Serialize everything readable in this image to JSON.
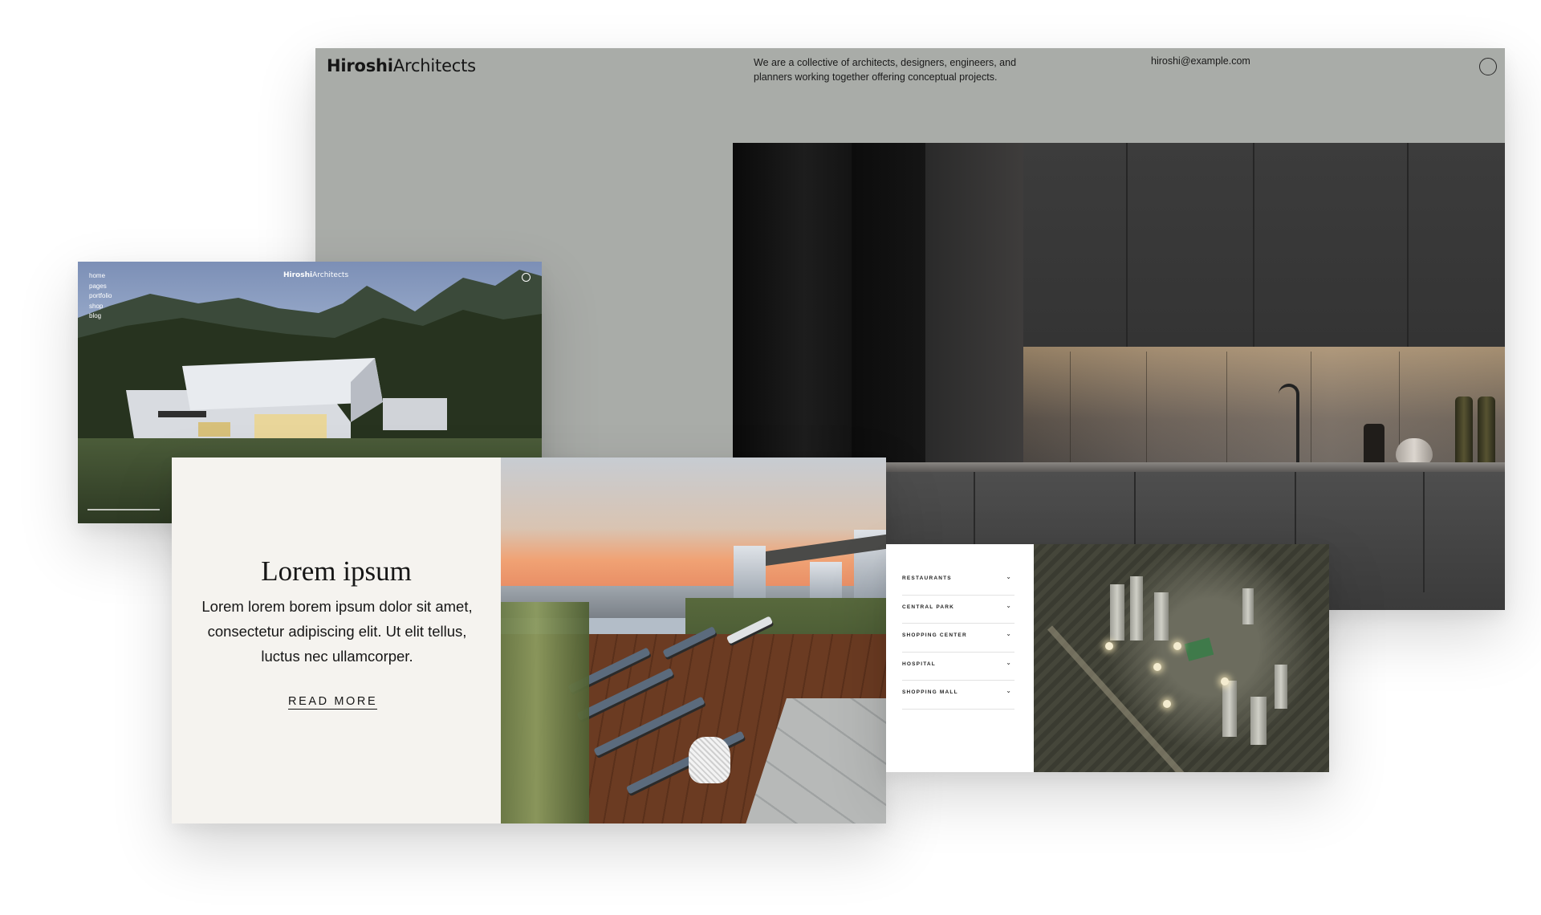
{
  "main_card": {
    "logo_bold": "Hiroshi",
    "logo_light": "Architects",
    "tagline": "We are a collective of architects, designers, engineers, and planners working together offering conceptual projects.",
    "email": "hiroshi@example.com",
    "background_color": "#a9aca8"
  },
  "house_card": {
    "logo_bold": "Hiroshi",
    "logo_light": "Architects",
    "nav": [
      "home",
      "pages",
      "portfolio",
      "shop",
      "blog"
    ]
  },
  "pool_card": {
    "title": "Lorem ipsum",
    "body": "Lorem lorem borem ipsum dolor sit amet, consectetur adipiscing elit. Ut elit tellus, luctus nec ullamcorper.",
    "link": "READ MORE",
    "background_color": "#f5f3ef"
  },
  "map_card": {
    "items": [
      {
        "label": "RESTAURANTS"
      },
      {
        "label": "CENTRAL PARK"
      },
      {
        "label": "SHOPPING CENTER"
      },
      {
        "label": "HOSPITAL"
      },
      {
        "label": "SHOPPING MALL"
      }
    ],
    "chevron": "⌄"
  }
}
